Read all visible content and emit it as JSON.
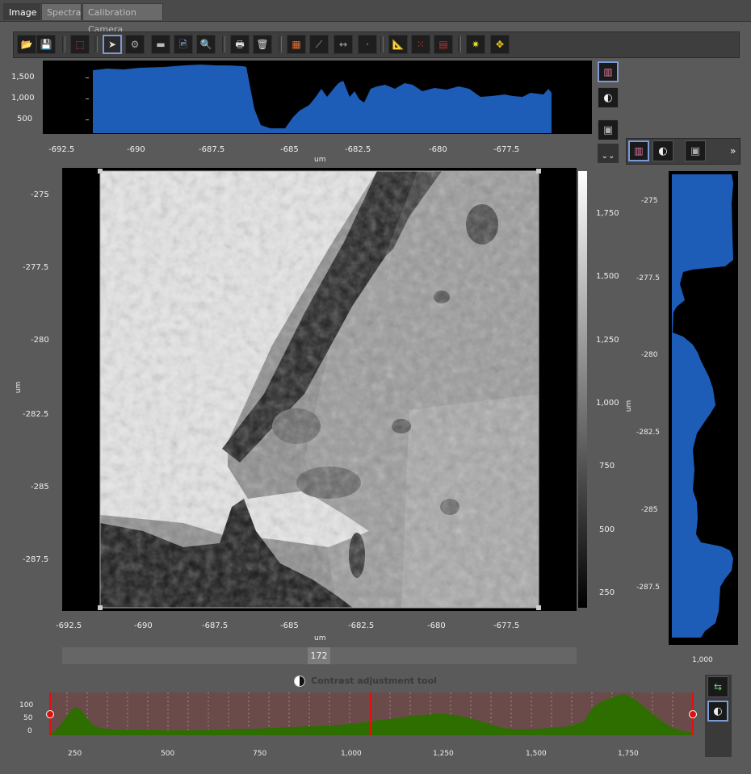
{
  "tabs": [
    "Image",
    "Spectra",
    "Calibration Camera"
  ],
  "toolbar": {
    "buttons": [
      {
        "name": "open-folder-icon",
        "glyph": "📂"
      },
      {
        "name": "save-icon",
        "glyph": "💾"
      },
      {
        "name": "roi-select-icon",
        "glyph": "⬚"
      },
      {
        "name": "pointer-icon",
        "glyph": "➤"
      },
      {
        "name": "settings-gear-icon",
        "glyph": "⚙"
      },
      {
        "name": "gradient-display-icon",
        "glyph": "▬"
      },
      {
        "name": "image-export-icon",
        "glyph": "🖻"
      },
      {
        "name": "zoom-icon",
        "glyph": "🔍"
      },
      {
        "name": "print-icon",
        "glyph": "🖶"
      },
      {
        "name": "delete-icon",
        "glyph": "🗑"
      },
      {
        "name": "layers-icon",
        "glyph": "▦"
      },
      {
        "name": "line-profile-icon",
        "glyph": "⟋"
      },
      {
        "name": "horizontal-profile-icon",
        "glyph": "↔"
      },
      {
        "name": "point-profile-icon",
        "glyph": "·"
      },
      {
        "name": "ruler-icon",
        "glyph": "📐"
      },
      {
        "name": "grid-points-icon",
        "glyph": "⁙"
      },
      {
        "name": "map-icon",
        "glyph": "▤"
      },
      {
        "name": "brightness-icon",
        "glyph": "✷"
      },
      {
        "name": "move-arrows-icon",
        "glyph": "✥"
      }
    ]
  },
  "top_profile": {
    "y_ticks": [
      "1,500",
      "1,000",
      "500"
    ],
    "x_ticks": [
      "-692.5",
      "-690",
      "-687.5",
      "-685",
      "-682.5",
      "-680",
      "-677.5"
    ],
    "x_unit": "um"
  },
  "main_image": {
    "y_ticks": [
      "-275",
      "-277.5",
      "-280",
      "-282.5",
      "-285",
      "-287.5"
    ],
    "x_ticks": [
      "-692.5",
      "-690",
      "-687.5",
      "-685",
      "-682.5",
      "-680",
      "-677.5"
    ],
    "x_unit": "um",
    "y_unit": "um",
    "colorbar_ticks": [
      "1,750",
      "1,500",
      "1,250",
      "1,000",
      "750",
      "500",
      "250"
    ]
  },
  "right_profile": {
    "y_ticks": [
      "-275",
      "-277.5",
      "-280",
      "-282.5",
      "-285",
      "-287.5"
    ],
    "x_ticks": [
      "1,000"
    ],
    "y_unit": "um"
  },
  "slider": {
    "value": "172"
  },
  "contrast_tool": {
    "title": "Contrast adjustment tool",
    "y_ticks": [
      "100",
      "50",
      "0"
    ],
    "x_ticks": [
      "250",
      "500",
      "750",
      "1,000",
      "1,250",
      "1,500",
      "1,750"
    ]
  },
  "colors": {
    "profile_fill": "#1d5db8",
    "histogram_fill": "#2e6e00",
    "histogram_bg": "#6b4a4a",
    "marker": "#e01010"
  }
}
